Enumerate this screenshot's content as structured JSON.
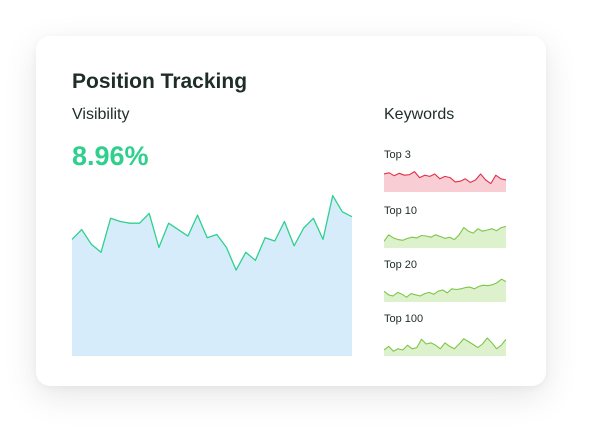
{
  "card": {
    "title": "Position Tracking",
    "visibility_label": "Visibility",
    "visibility_value": "8.96%",
    "keywords_label": "Keywords"
  },
  "colors": {
    "accent_green": "#2fd08e",
    "area_blue": "#d6ecfa",
    "positive_line": "#7dc64a",
    "positive_fill": "#ddf2cc",
    "negative_line": "#e1304a",
    "negative_fill": "#f9cdd4"
  },
  "chart_data": [
    {
      "type": "area",
      "label": "Visibility",
      "ylim": [
        0,
        1
      ],
      "values": [
        0.72,
        0.78,
        0.69,
        0.64,
        0.85,
        0.83,
        0.82,
        0.82,
        0.88,
        0.67,
        0.82,
        0.78,
        0.74,
        0.87,
        0.73,
        0.75,
        0.67,
        0.53,
        0.64,
        0.59,
        0.73,
        0.71,
        0.83,
        0.68,
        0.79,
        0.85,
        0.72,
        0.99,
        0.89,
        0.86
      ]
    },
    {
      "type": "area",
      "label": "Top 3",
      "trend": "negative",
      "ylim": [
        0,
        1
      ],
      "values": [
        0.75,
        0.8,
        0.68,
        0.78,
        0.7,
        0.72,
        0.85,
        0.6,
        0.7,
        0.65,
        0.75,
        0.55,
        0.65,
        0.6,
        0.42,
        0.45,
        0.55,
        0.4,
        0.5,
        0.75,
        0.5,
        0.35,
        0.7,
        0.55,
        0.5
      ]
    },
    {
      "type": "area",
      "label": "Top 10",
      "trend": "positive",
      "ylim": [
        0,
        1
      ],
      "values": [
        0.28,
        0.55,
        0.42,
        0.35,
        0.32,
        0.4,
        0.45,
        0.42,
        0.52,
        0.5,
        0.45,
        0.55,
        0.48,
        0.4,
        0.45,
        0.35,
        0.55,
        0.85,
        0.7,
        0.62,
        0.8,
        0.7,
        0.75,
        0.8,
        0.72,
        0.85,
        0.9
      ]
    },
    {
      "type": "area",
      "label": "Top 20",
      "trend": "positive",
      "ylim": [
        0,
        1
      ],
      "values": [
        0.45,
        0.3,
        0.25,
        0.4,
        0.32,
        0.2,
        0.35,
        0.3,
        0.25,
        0.35,
        0.4,
        0.32,
        0.45,
        0.5,
        0.38,
        0.55,
        0.52,
        0.55,
        0.6,
        0.62,
        0.55,
        0.65,
        0.7,
        0.68,
        0.72,
        0.8,
        0.95,
        0.85
      ]
    },
    {
      "type": "area",
      "label": "Top 100",
      "trend": "positive",
      "ylim": [
        0,
        1
      ],
      "values": [
        0.25,
        0.4,
        0.2,
        0.3,
        0.25,
        0.45,
        0.3,
        0.35,
        0.7,
        0.5,
        0.55,
        0.45,
        0.3,
        0.55,
        0.4,
        0.3,
        0.5,
        0.72,
        0.6,
        0.48,
        0.35,
        0.5,
        0.75,
        0.55,
        0.3,
        0.45,
        0.7
      ]
    }
  ]
}
